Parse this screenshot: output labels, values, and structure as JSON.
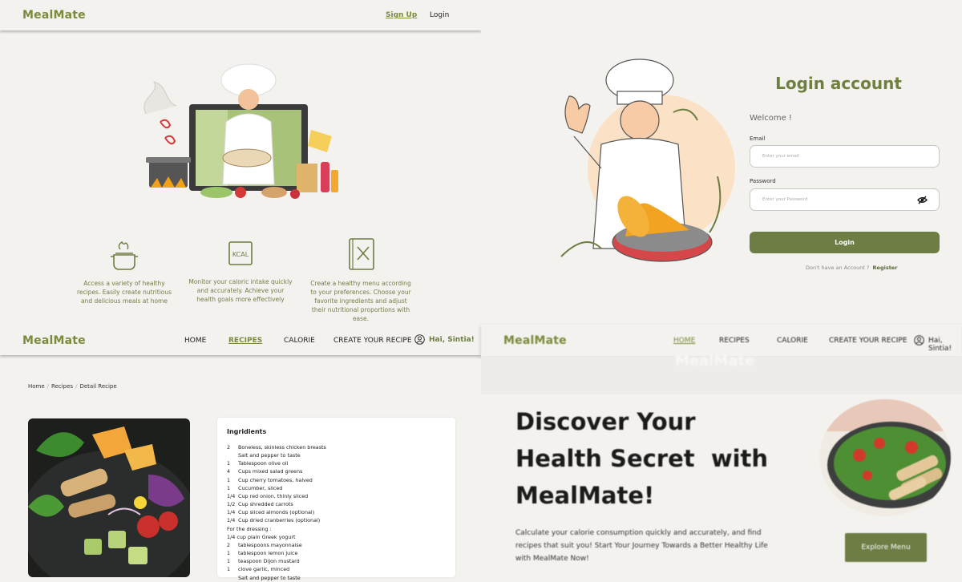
{
  "landing": {
    "brand": "MealMate",
    "nav": {
      "signup": "Sign Up",
      "login": "Login"
    },
    "features": [
      {
        "icon": "cooking-pot-icon",
        "text": "Access a variety of healthy recipes. Easily create nutritious and delicious meals at home"
      },
      {
        "icon": "kcal-icon",
        "text": "Monitor your caloric intake quickly and accurately. Achieve your health goals more effectively"
      },
      {
        "icon": "recipe-book-icon",
        "text": "Create a healthy menu according to your preferences. Choose your favorite ingredients and adjust their nutritional proportions with ease."
      }
    ]
  },
  "login": {
    "title": "Login account",
    "welcome": "Welcome !",
    "email_label": "Email",
    "email_placeholder": "Enter your email",
    "password_label": "Password",
    "password_placeholder": "Enter your Password",
    "button": "Login",
    "no_account": "Don't have an Account ?",
    "register": "Register"
  },
  "recipe_page": {
    "brand": "MealMate",
    "nav": [
      "HOME",
      "RECIPES",
      "CALORIE",
      "CREATE YOUR RECIPE"
    ],
    "user": "Hai, Sintia!",
    "breadcrumb": [
      "Home",
      "Recipes",
      "Detail Recipe"
    ],
    "ingredients_title": "Ingridients",
    "ingredients": [
      {
        "qty": "2",
        "item": "Boneless, skinless chicken breasts"
      },
      {
        "qty": "",
        "item": "Salt and pepper to taste"
      },
      {
        "qty": "1",
        "item": "Tablespoon olive oil"
      },
      {
        "qty": "4",
        "item": "Cups mixed salad greens"
      },
      {
        "qty": "1",
        "item": "Cup cherry tomatoes, halved"
      },
      {
        "qty": "1",
        "item": "Cucumber, sliced"
      },
      {
        "qty": "1/4",
        "item": "Cup red onion, thinly sliced"
      },
      {
        "qty": "1/2",
        "item": "Cup shredded carrots"
      },
      {
        "qty": "1/4",
        "item": "Cup sliced almonds (optional)"
      },
      {
        "qty": "1/4",
        "item": "Cup dried cranberries (optional)"
      },
      {
        "qty": "",
        "item": "For the dressing :"
      },
      {
        "qty": "",
        "item": "1/4 cup plain Greek yogurt"
      },
      {
        "qty": "2",
        "item": "tablespoons mayonnaise"
      },
      {
        "qty": "1",
        "item": "tablespoon lemon juice"
      },
      {
        "qty": "1",
        "item": "teaspoon Dijon mustard"
      },
      {
        "qty": "1",
        "item": "clove garlic, minced"
      },
      {
        "qty": "",
        "item": "Salt and pepper to taste"
      }
    ]
  },
  "home_page": {
    "brand": "MealMate",
    "nav": [
      "HOME",
      "RECIPES",
      "CALORIE",
      "CREATE YOUR RECIPE"
    ],
    "user": "Hai, Sintia!",
    "ghost_brand": "MealMate",
    "headline": [
      "Discover Your",
      "Health Secret  with",
      "MealMate!"
    ],
    "subtext": "Calculate your calorie consumption quickly and accurately, and find recipes that suit you! Start Your Journey Towards a Better Healthy Life with MealMate Now!",
    "cta": "Explore Menu"
  },
  "colors": {
    "brand_green": "#6d7d43",
    "logo_green": "#7b8a3c",
    "background": "#f4f2ee"
  }
}
